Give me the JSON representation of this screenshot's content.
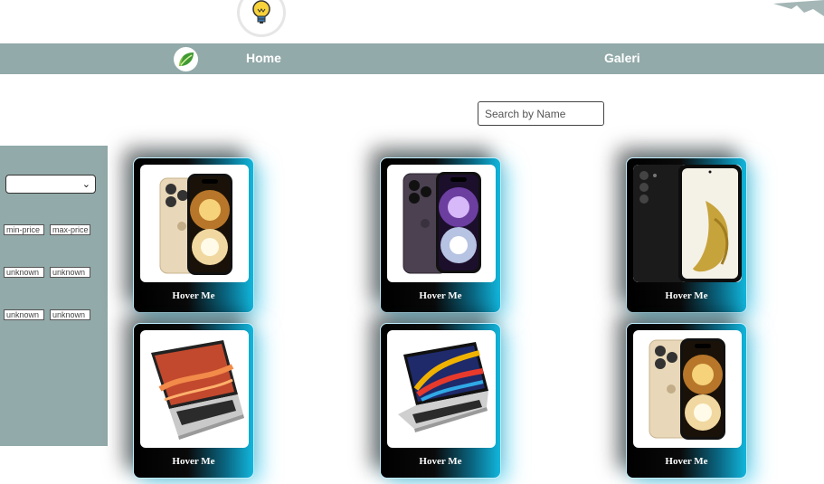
{
  "header": {
    "logo_icon": "lightbulb-icon",
    "corner_icon": "decorative-shape"
  },
  "nav": {
    "brand_icon": "leaf-logo-icon",
    "links": [
      {
        "label": "Home"
      },
      {
        "label": "Galeri"
      }
    ]
  },
  "search": {
    "placeholder": "Search by Name",
    "value": ""
  },
  "filters": {
    "select_value": "",
    "price_min_placeholder": "min-price",
    "price_max_placeholder": "max-price",
    "row2_min_placeholder": "unknown",
    "row2_max_placeholder": "unknown",
    "row3_min_placeholder": "unknown",
    "row3_max_placeholder": "unknown"
  },
  "products": [
    {
      "label": "Hover Me",
      "image": "iphone-14-pro-gold"
    },
    {
      "label": "Hover Me",
      "image": "iphone-14-pro-purple"
    },
    {
      "label": "Hover Me",
      "image": "samsung-galaxy-s22"
    },
    {
      "label": "Hover Me",
      "image": "laptop-silver-orange"
    },
    {
      "label": "Hover Me",
      "image": "laptop-silver-colorful"
    },
    {
      "label": "Hover Me",
      "image": "iphone-14-pro-gold"
    }
  ],
  "colors": {
    "nav_bg": "#92aaa9",
    "card_accent": "#12b6dc"
  }
}
